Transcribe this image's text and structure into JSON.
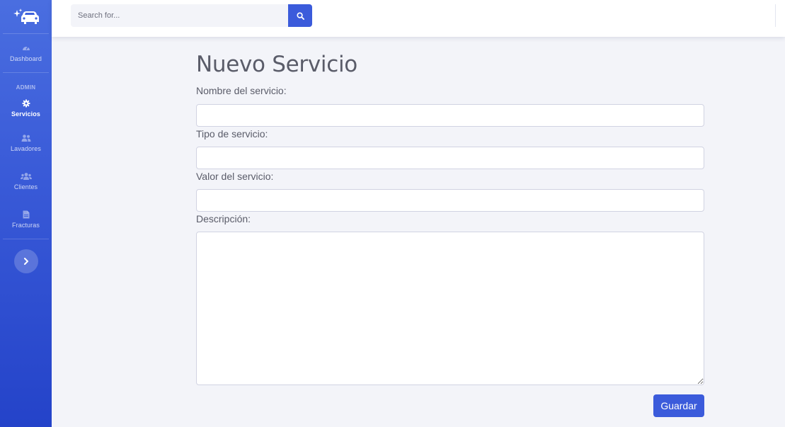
{
  "sidebar": {
    "brand_icon": "car-wash-icon",
    "items": [
      {
        "label": "Dashboard",
        "icon": "tachometer-icon",
        "active": false
      },
      {
        "label": "Servicios",
        "icon": "gear-icon",
        "active": true
      },
      {
        "label": "Lavadores",
        "icon": "user-friends-icon",
        "active": false
      },
      {
        "label": "Clientes",
        "icon": "users-icon",
        "active": false
      },
      {
        "label": "Fracturas",
        "icon": "file-invoice-icon",
        "active": false
      }
    ],
    "section_heading": "ADMIN",
    "toggle_icon": "chevron-right-icon"
  },
  "topbar": {
    "search": {
      "placeholder": "Search for...",
      "value": ""
    },
    "search_icon": "search-icon"
  },
  "form": {
    "title": "Nuevo Servicio",
    "fields": {
      "nombre": {
        "label": "Nombre del servicio:",
        "value": ""
      },
      "tipo": {
        "label": "Tipo de servicio:",
        "value": ""
      },
      "valor": {
        "label": "Valor del servicio:",
        "value": ""
      },
      "descripcion": {
        "label": "Descripción:",
        "value": ""
      }
    },
    "submit_label": "Guardar"
  },
  "colors": {
    "primary": "#3b5bdb",
    "sidebar_top": "#4a6ee0",
    "sidebar_bottom": "#2443c9",
    "background": "#f3f4f9",
    "text": "#5a5c69"
  }
}
